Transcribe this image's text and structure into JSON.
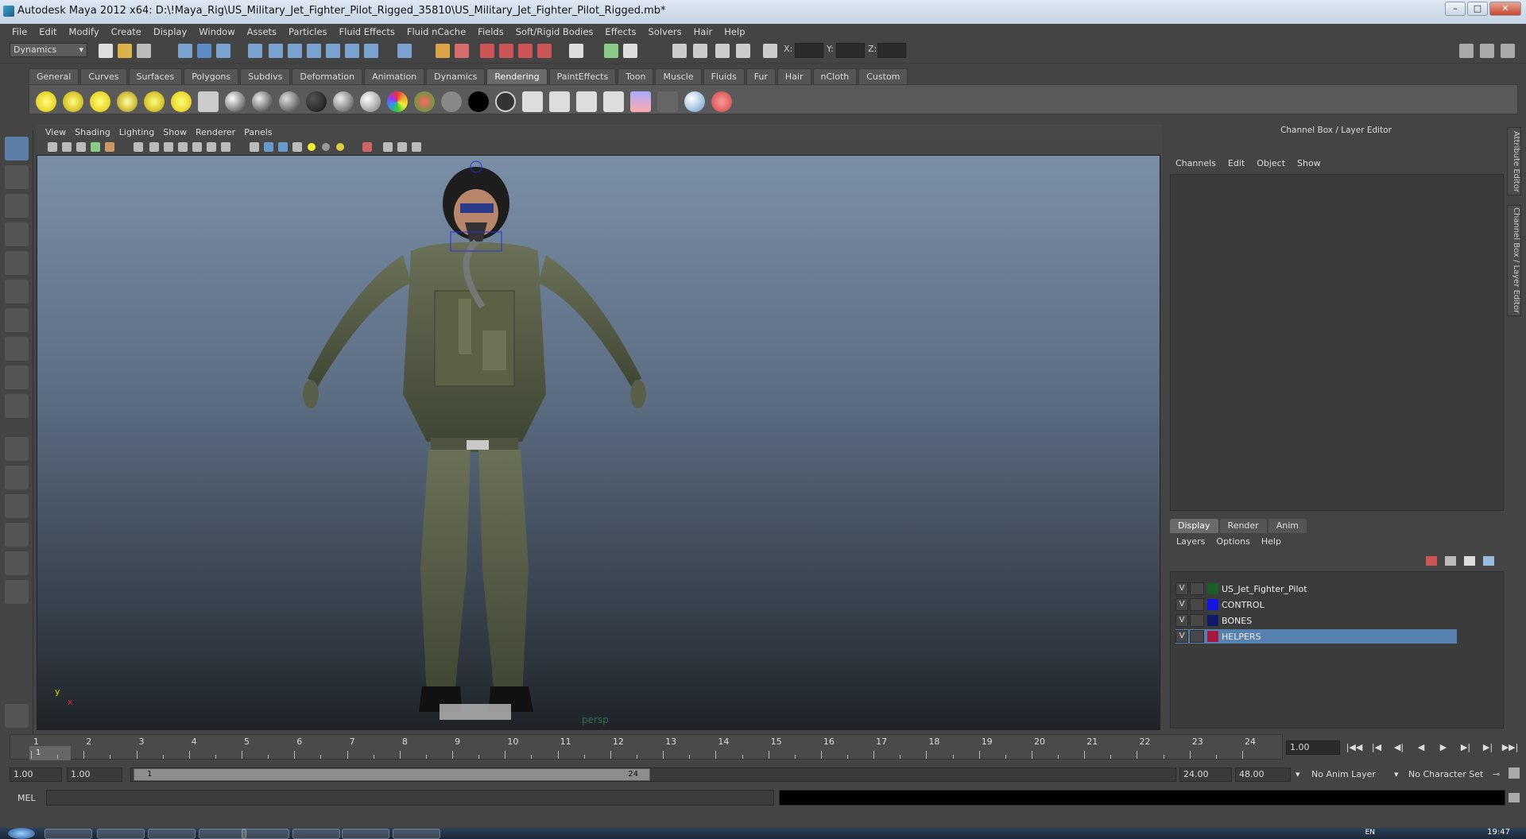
{
  "window": {
    "title": "Autodesk Maya 2012 x64: D:\\!Maya_Rig\\US_Military_Jet_Fighter_Pilot_Rigged_35810\\US_Military_Jet_Fighter_Pilot_Rigged.mb*",
    "minimize": "–",
    "maximize": "□",
    "close": "✕"
  },
  "menubar": [
    "File",
    "Edit",
    "Modify",
    "Create",
    "Display",
    "Window",
    "Assets",
    "Particles",
    "Fluid Effects",
    "Fluid nCache",
    "Fields",
    "Soft/Rigid Bodies",
    "Effects",
    "Solvers",
    "Hair",
    "Help"
  ],
  "statusline": {
    "menu_set": "Dynamics",
    "x_label": "X:",
    "y_label": "Y:",
    "z_label": "Z:"
  },
  "shelf": {
    "tabs": [
      "General",
      "Curves",
      "Surfaces",
      "Polygons",
      "Subdivs",
      "Deformation",
      "Animation",
      "Dynamics",
      "Rendering",
      "PaintEffects",
      "Toon",
      "Muscle",
      "Fluids",
      "Fur",
      "Hair",
      "nCloth",
      "Custom"
    ],
    "active_tab": "Rendering"
  },
  "viewport": {
    "menus": [
      "View",
      "Shading",
      "Lighting",
      "Show",
      "Renderer",
      "Panels"
    ],
    "camera_label": "persp",
    "axis_y": "y",
    "axis_x": "x"
  },
  "channel_box": {
    "title": "Channel Box / Layer Editor",
    "menus": [
      "Channels",
      "Edit",
      "Object",
      "Show"
    ]
  },
  "side_tabs": {
    "attribute_editor": "Attribute Editor",
    "channel_box": "Channel Box / Layer Editor"
  },
  "layer_editor": {
    "tabs": [
      "Display",
      "Render",
      "Anim"
    ],
    "active_tab": "Display",
    "menus": [
      "Layers",
      "Options",
      "Help"
    ],
    "layers": [
      {
        "visible": "V",
        "name": "US_Jet_Fighter_Pilot",
        "color": "#1b5e2a",
        "selected": false
      },
      {
        "visible": "V",
        "name": "CONTROL",
        "color": "#1414e6",
        "selected": false
      },
      {
        "visible": "V",
        "name": "BONES",
        "color": "#101a6a",
        "selected": false
      },
      {
        "visible": "V",
        "name": "HELPERS",
        "color": "#a8183e",
        "selected": true
      }
    ]
  },
  "timeline": {
    "ticks": [
      "1",
      "2",
      "3",
      "4",
      "5",
      "6",
      "7",
      "8",
      "9",
      "10",
      "11",
      "12",
      "13",
      "14",
      "15",
      "16",
      "17",
      "18",
      "19",
      "20",
      "21",
      "22",
      "23",
      "24"
    ],
    "current_frame": "1",
    "current_time_field": "1.00"
  },
  "playback": {
    "go_start": "|◀◀",
    "step_back_key": "|◀",
    "step_back": "◀|",
    "play_back": "◀",
    "play_forward": "▶",
    "step_forward": "▶|",
    "step_forward_key": "▶|",
    "go_end": "▶▶|"
  },
  "range": {
    "start_time": "1.00",
    "playback_start": "1.00",
    "slider_start": "1",
    "slider_end": "24",
    "playback_end": "24.00",
    "end_time": "48.00",
    "anim_layer": "No Anim Layer",
    "character_set": "No Character Set"
  },
  "command_line": {
    "mel_label": "MEL"
  },
  "taskbar": {
    "lang": "EN",
    "clock": "19:47"
  }
}
